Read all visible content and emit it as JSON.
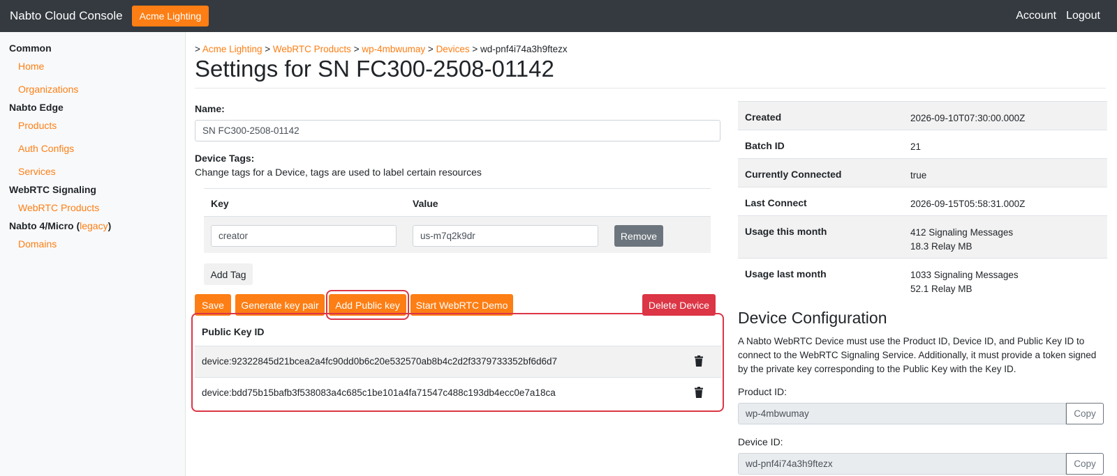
{
  "topbar": {
    "brand": "Nabto Cloud Console",
    "org_button": "Acme Lighting",
    "account": "Account",
    "logout": "Logout"
  },
  "sidebar": {
    "common": "Common",
    "home": "Home",
    "organizations": "Organizations",
    "edge": "Nabto Edge",
    "products": "Products",
    "auth_configs": "Auth Configs",
    "services": "Services",
    "webrtc": "WebRTC Signaling",
    "webrtc_products": "WebRTC Products",
    "micro": "Nabto 4/Micro (",
    "legacy": "legacy",
    "micro_close": ")",
    "domains": "Domains"
  },
  "breadcrumb": {
    "prefix": ">",
    "sep": ">",
    "items": [
      "Acme Lighting",
      "WebRTC Products",
      "wp-4mbwumay",
      "Devices"
    ],
    "current": "wd-pnf4i74a3h9ftezx"
  },
  "page_title": "Settings for SN FC300-2508-01142",
  "form": {
    "name_label": "Name:",
    "name_value": "SN FC300-2508-01142",
    "tags_label": "Device Tags:",
    "tags_help": "Change tags for a Device, tags are used to label certain resources",
    "key_header": "Key",
    "value_header": "Value",
    "tag_key": "creator",
    "tag_value": "us-m7q2k9dr",
    "remove": "Remove",
    "add_tag": "Add Tag"
  },
  "actions": {
    "save": "Save",
    "generate": "Generate key pair",
    "add_public_key": "Add Public key",
    "start_demo": "Start WebRTC Demo",
    "delete": "Delete Device"
  },
  "public_keys": {
    "header": "Public Key ID",
    "rows": [
      "device:92322845d21bcea2a4fc90dd0b6c20e532570ab8b4c2d2f3379733352bf6d6d7",
      "device:bdd75b15bafb3f538083a4c685c1be101a4fa71547c488c193db4ecc0e7a18ca"
    ]
  },
  "details": {
    "created_k": "Created",
    "created_v": "2026-09-10T07:30:00.000Z",
    "batch_k": "Batch ID",
    "batch_v": "21",
    "connected_k": "Currently Connected",
    "connected_v": "true",
    "last_k": "Last Connect",
    "last_v": "2026-09-15T05:58:31.000Z",
    "usage_this_k": "Usage this month",
    "usage_this_1": "412 Signaling Messages",
    "usage_this_2": "18.3 Relay MB",
    "usage_last_k": "Usage last month",
    "usage_last_1": "1033 Signaling Messages",
    "usage_last_2": "52.1 Relay MB"
  },
  "config": {
    "title": "Device Configuration",
    "desc": "A Nabto WebRTC Device must use the Product ID, Device ID, and Public Key ID to connect to the WebRTC Signaling Service. Additionally, it must provide a token signed by the private key corresponding to the Public Key with the Key ID.",
    "product_label": "Product ID:",
    "product_value": "wp-4mbwumay",
    "device_label": "Device ID:",
    "device_value": "wd-pnf4i74a3h9ftezx",
    "copy": "Copy"
  },
  "colors": {
    "accent": "#fd7e14",
    "danger": "#dc3545",
    "navbar": "#343a40",
    "secondary": "#6c757d"
  }
}
